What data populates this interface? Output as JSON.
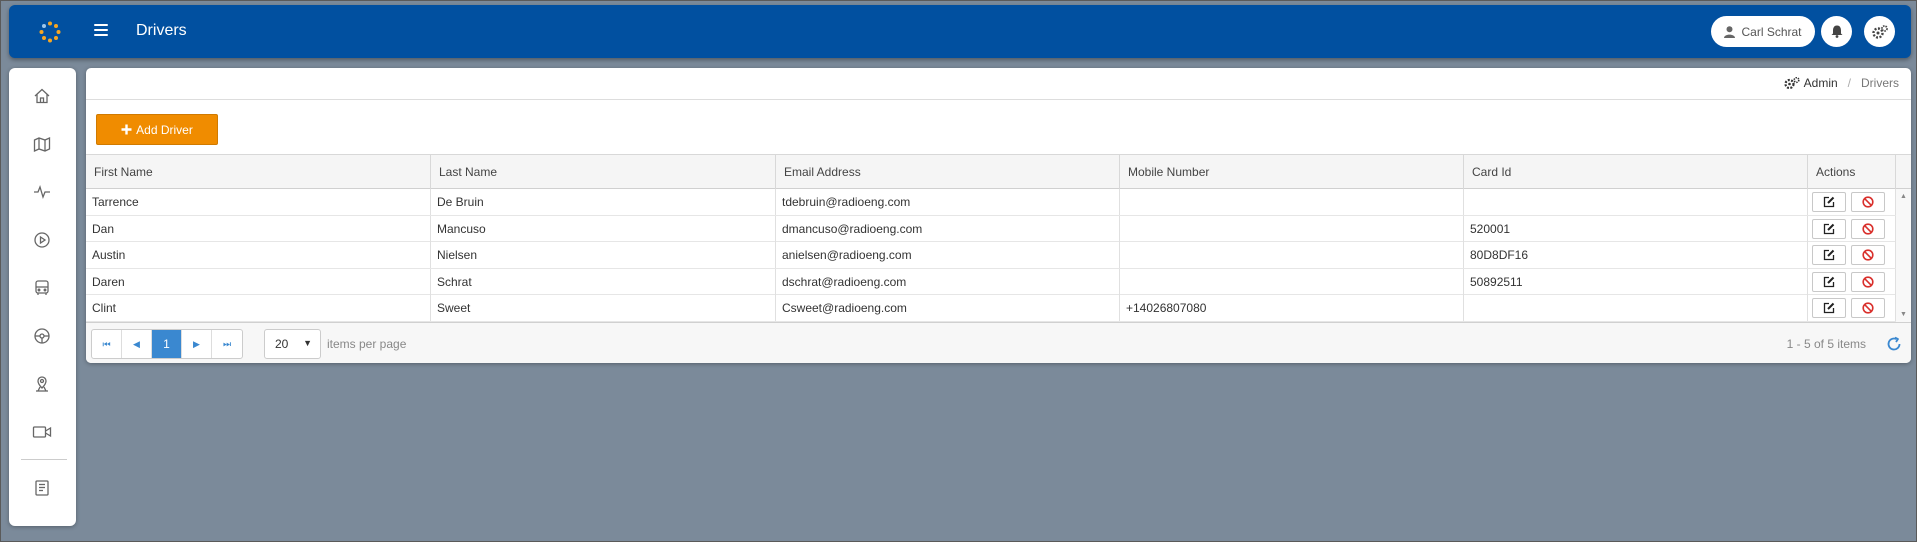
{
  "header": {
    "title": "Drivers",
    "user_name": "Carl Schrat"
  },
  "sidebar": {
    "items": [
      {
        "icon": "home-icon"
      },
      {
        "icon": "map-icon"
      },
      {
        "icon": "activity-icon"
      },
      {
        "icon": "play-icon"
      },
      {
        "icon": "bus-icon"
      },
      {
        "icon": "steering-wheel-icon"
      },
      {
        "icon": "location-pin-icon"
      },
      {
        "icon": "video-camera-icon"
      },
      {
        "icon": "book-icon"
      }
    ]
  },
  "breadcrumb": {
    "admin": "Admin",
    "current": "Drivers"
  },
  "toolbar": {
    "add_label": "Add Driver"
  },
  "grid": {
    "columns": [
      "First Name",
      "Last Name",
      "Email Address",
      "Mobile Number",
      "Card Id",
      "Actions"
    ],
    "rows": [
      {
        "first": "Tarrence",
        "last": "De Bruin",
        "email": "tdebruin@radioeng.com",
        "mobile": "",
        "card": ""
      },
      {
        "first": "Dan",
        "last": "Mancuso",
        "email": "dmancuso@radioeng.com",
        "mobile": "",
        "card": "520001"
      },
      {
        "first": "Austin",
        "last": "Nielsen",
        "email": "anielsen@radioeng.com",
        "mobile": "",
        "card": "80D8DF16"
      },
      {
        "first": "Daren",
        "last": "Schrat",
        "email": "dschrat@radioeng.com",
        "mobile": "",
        "card": "50892511"
      },
      {
        "first": "Clint",
        "last": "Sweet",
        "email": "Csweet@radioeng.com",
        "mobile": "+14026807080",
        "card": ""
      }
    ]
  },
  "pager": {
    "current_page": "1",
    "page_size": "20",
    "per_page_label": "items per page",
    "info": "1 - 5 of 5 items"
  },
  "colors": {
    "topbar": "#0150a0",
    "accent": "#f08c00",
    "page_active": "#3a88d0",
    "danger": "#d9302c"
  }
}
